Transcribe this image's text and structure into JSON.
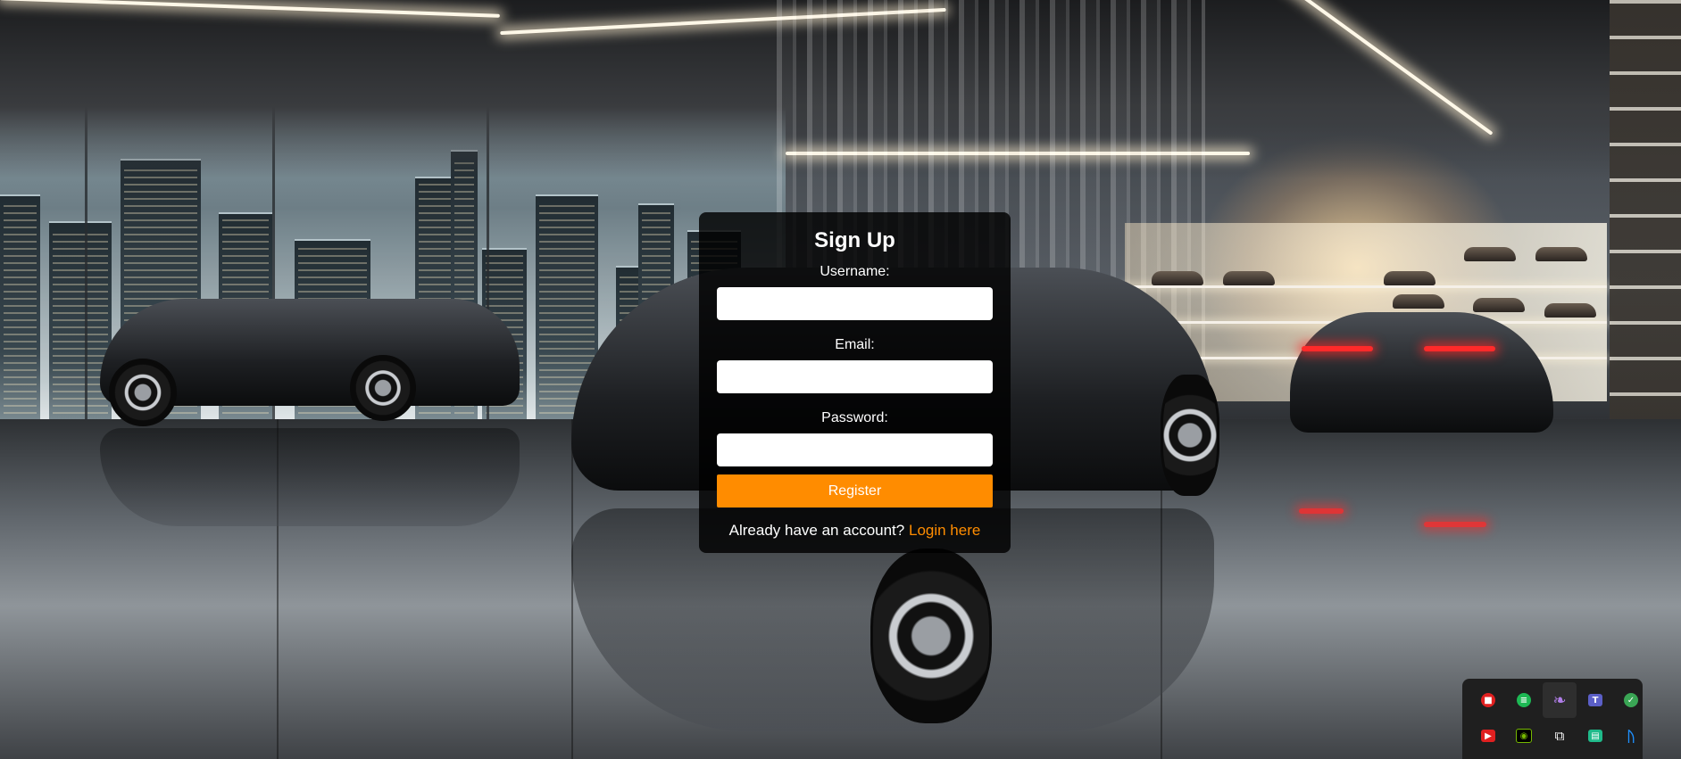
{
  "form": {
    "title": "Sign Up",
    "username_label": "Username:",
    "username_value": "",
    "email_label": "Email:",
    "email_value": "",
    "password_label": "Password:",
    "password_value": "",
    "register_label": "Register",
    "footer_text": "Already have an account?",
    "login_link": "Login here"
  },
  "colors": {
    "accent": "#ff8c00",
    "card_background": "rgba(0,0,0,0.82)"
  },
  "tray_icons": [
    {
      "name": "red-app-icon",
      "color": "#e02020"
    },
    {
      "name": "spotify-icon",
      "color": "#1db954"
    },
    {
      "name": "feather-icon",
      "color": "#9b59d6"
    },
    {
      "name": "teams-icon",
      "color": "#5b5fc7"
    },
    {
      "name": "globe-status-icon",
      "color": "#3aa655"
    },
    {
      "name": "red-app-secondary-icon",
      "color": "#e02020"
    },
    {
      "name": "nvidia-icon",
      "color": "#76b900"
    },
    {
      "name": "copy-windows-icon",
      "color": "#ffffff"
    },
    {
      "name": "green-app-icon",
      "color": "#1fba8a"
    },
    {
      "name": "bluetooth-icon",
      "color": "#1e90ff"
    }
  ]
}
